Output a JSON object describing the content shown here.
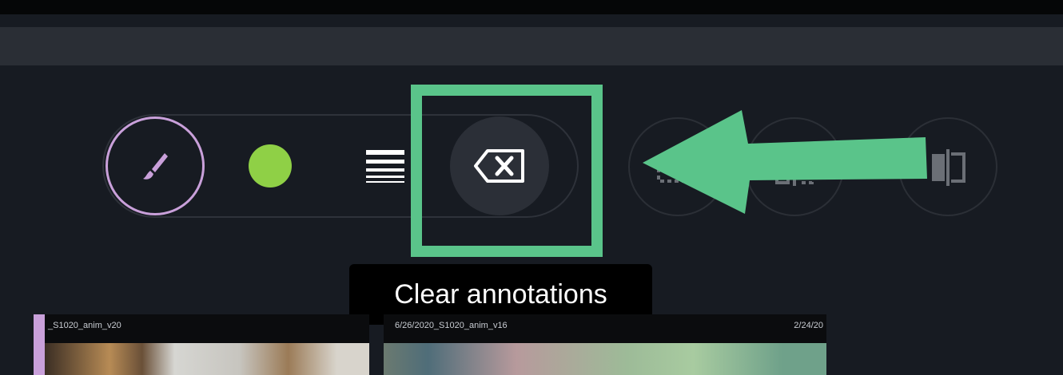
{
  "toolbar": {
    "brush_tool_icon": "paintbrush-icon",
    "color_swatch": "#8fd046",
    "line_width_icon": "line-width-icon",
    "clear_icon": "backspace-icon",
    "other_tool_icons": [
      "crop-icon",
      "split-view-icon",
      "compare-icon"
    ]
  },
  "tooltip": {
    "text": "Clear annotations"
  },
  "highlight": {
    "color": "#5ac48a"
  },
  "thumbnails": [
    {
      "caption": "_S1020_anim_v20"
    },
    {
      "caption": "6/26/2020_S1020_anim_v16",
      "date": "2/24/20"
    }
  ],
  "colors": {
    "accent_brush": "#c9a0da",
    "background": "#171b22"
  }
}
